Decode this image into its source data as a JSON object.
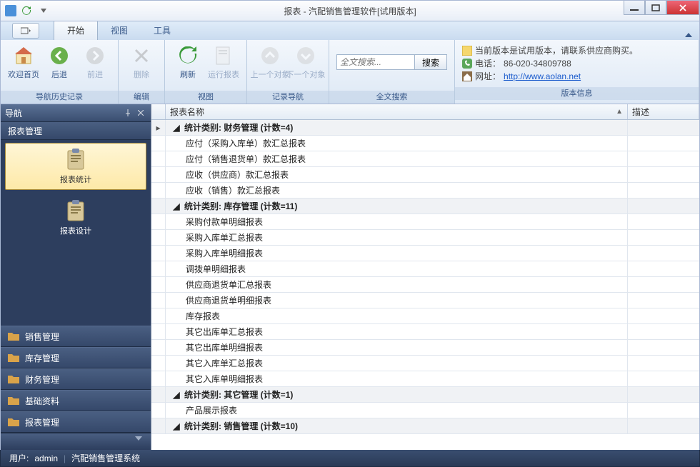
{
  "window": {
    "title": "报表 - 汽配销售管理软件[试用版本]"
  },
  "tabs": {
    "start": "开始",
    "view": "视图",
    "tools": "工具"
  },
  "ribbon": {
    "nav_history": "导航历史记录",
    "edit": "编辑",
    "view": "视图",
    "record_nav": "记录导航",
    "fulltext": "全文搜索",
    "version": "版本信息",
    "welcome": "欢迎首页",
    "back": "后退",
    "forward": "前进",
    "delete": "删除",
    "refresh": "刷新",
    "run_report": "运行报表",
    "prev_obj": "上一个对象",
    "next_obj": "下一个对象",
    "search_placeholder": "全文搜索...",
    "search_btn": "搜索"
  },
  "version": {
    "trial_msg": "当前版本是试用版本，请联系供应商购买。",
    "phone_label": "电话：",
    "phone": "86-020-34809788",
    "site_label": "网址：",
    "site": "http://www.aolan.net"
  },
  "sidebar": {
    "title": "导航",
    "section": "报表管理",
    "tile_stats": "报表统计",
    "tile_design": "报表设计",
    "items": {
      "sales": "销售管理",
      "stock": "库存管理",
      "finance": "财务管理",
      "base": "基础资料",
      "report": "报表管理"
    }
  },
  "grid": {
    "col_name": "报表名称",
    "col_desc": "描述",
    "groups": [
      {
        "key": "g1",
        "label": "统计类别: 财务管理 (计数=4)",
        "expanded": true,
        "rows": [
          "应付（采购入库单）款汇总报表",
          "应付（销售退货单）款汇总报表",
          "应收（供应商）款汇总报表",
          "应收（销售）款汇总报表"
        ]
      },
      {
        "key": "g2",
        "label": "统计类别: 库存管理 (计数=11)",
        "expanded": true,
        "rows": [
          "采购付款单明细报表",
          "采购入库单汇总报表",
          "采购入库单明细报表",
          "调拨单明细报表",
          "供应商退货单汇总报表",
          "供应商退货单明细报表",
          "库存报表",
          "其它出库单汇总报表",
          "其它出库单明细报表",
          "其它入库单汇总报表",
          "其它入库单明细报表"
        ]
      },
      {
        "key": "g3",
        "label": "统计类别: 其它管理 (计数=1)",
        "expanded": true,
        "rows": [
          "产品展示报表"
        ]
      },
      {
        "key": "g4",
        "label": "统计类别: 销售管理 (计数=10)",
        "expanded": true,
        "rows": []
      }
    ]
  },
  "status": {
    "user_label": "用户:",
    "user": "admin",
    "system": "汽配销售管理系统"
  }
}
